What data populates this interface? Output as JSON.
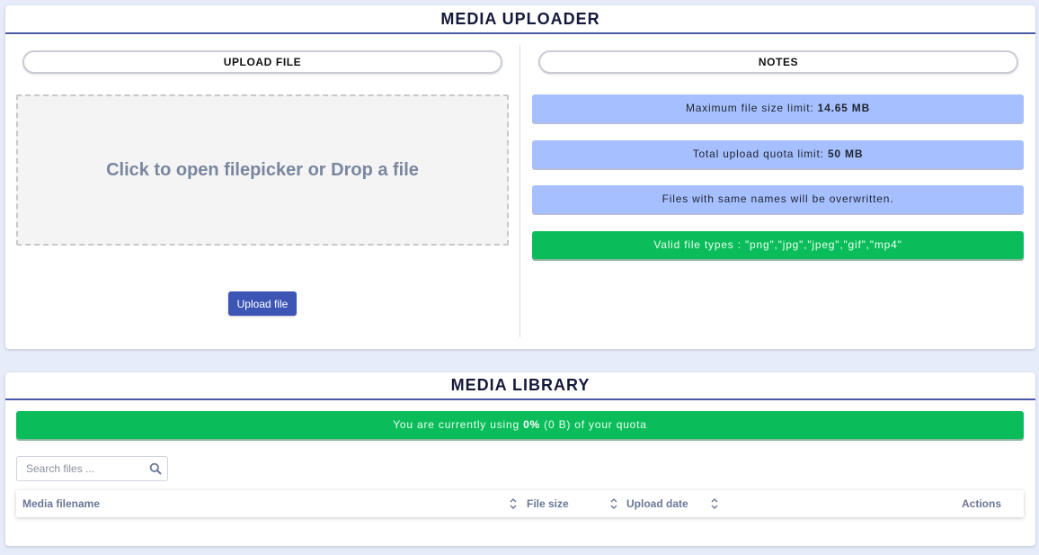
{
  "uploader": {
    "title": "MEDIA UPLOADER",
    "upload_section_label": "UPLOAD FILE",
    "notes_section_label": "NOTES",
    "dropzone_text": "Click to open filepicker or Drop a file",
    "upload_button_label": "Upload file",
    "notes": [
      {
        "prefix": "Maximum file size limit: ",
        "value": "14.65 MB",
        "color": "#a6c0ff"
      },
      {
        "prefix": "Total upload quota limit: ",
        "value": "50 MB",
        "color": "#a6c0ff"
      },
      {
        "prefix": "Files with same names will be overwritten.",
        "value": "",
        "color": "#a6c0ff"
      },
      {
        "prefix": "Valid file types : \"png\",\"jpg\",\"jpeg\",\"gif\",\"mp4\"",
        "value": "",
        "color": "#0bbd5a"
      }
    ]
  },
  "library": {
    "title": "MEDIA LIBRARY",
    "quota_prefix": "You are currently using ",
    "quota_percent": "0%",
    "quota_suffix": " (0 B) of your quota",
    "search_placeholder": "Search files ...",
    "columns": {
      "filename": "Media filename",
      "size": "File size",
      "date": "Upload date",
      "actions": "Actions"
    }
  },
  "icons": {
    "search": "search-icon",
    "sort": "sort-icon"
  },
  "colors": {
    "accent": "#3d56b5",
    "note_blue": "#a6c0ff",
    "success_green": "#0bbd5a",
    "title_underline": "#4b5aa8"
  }
}
